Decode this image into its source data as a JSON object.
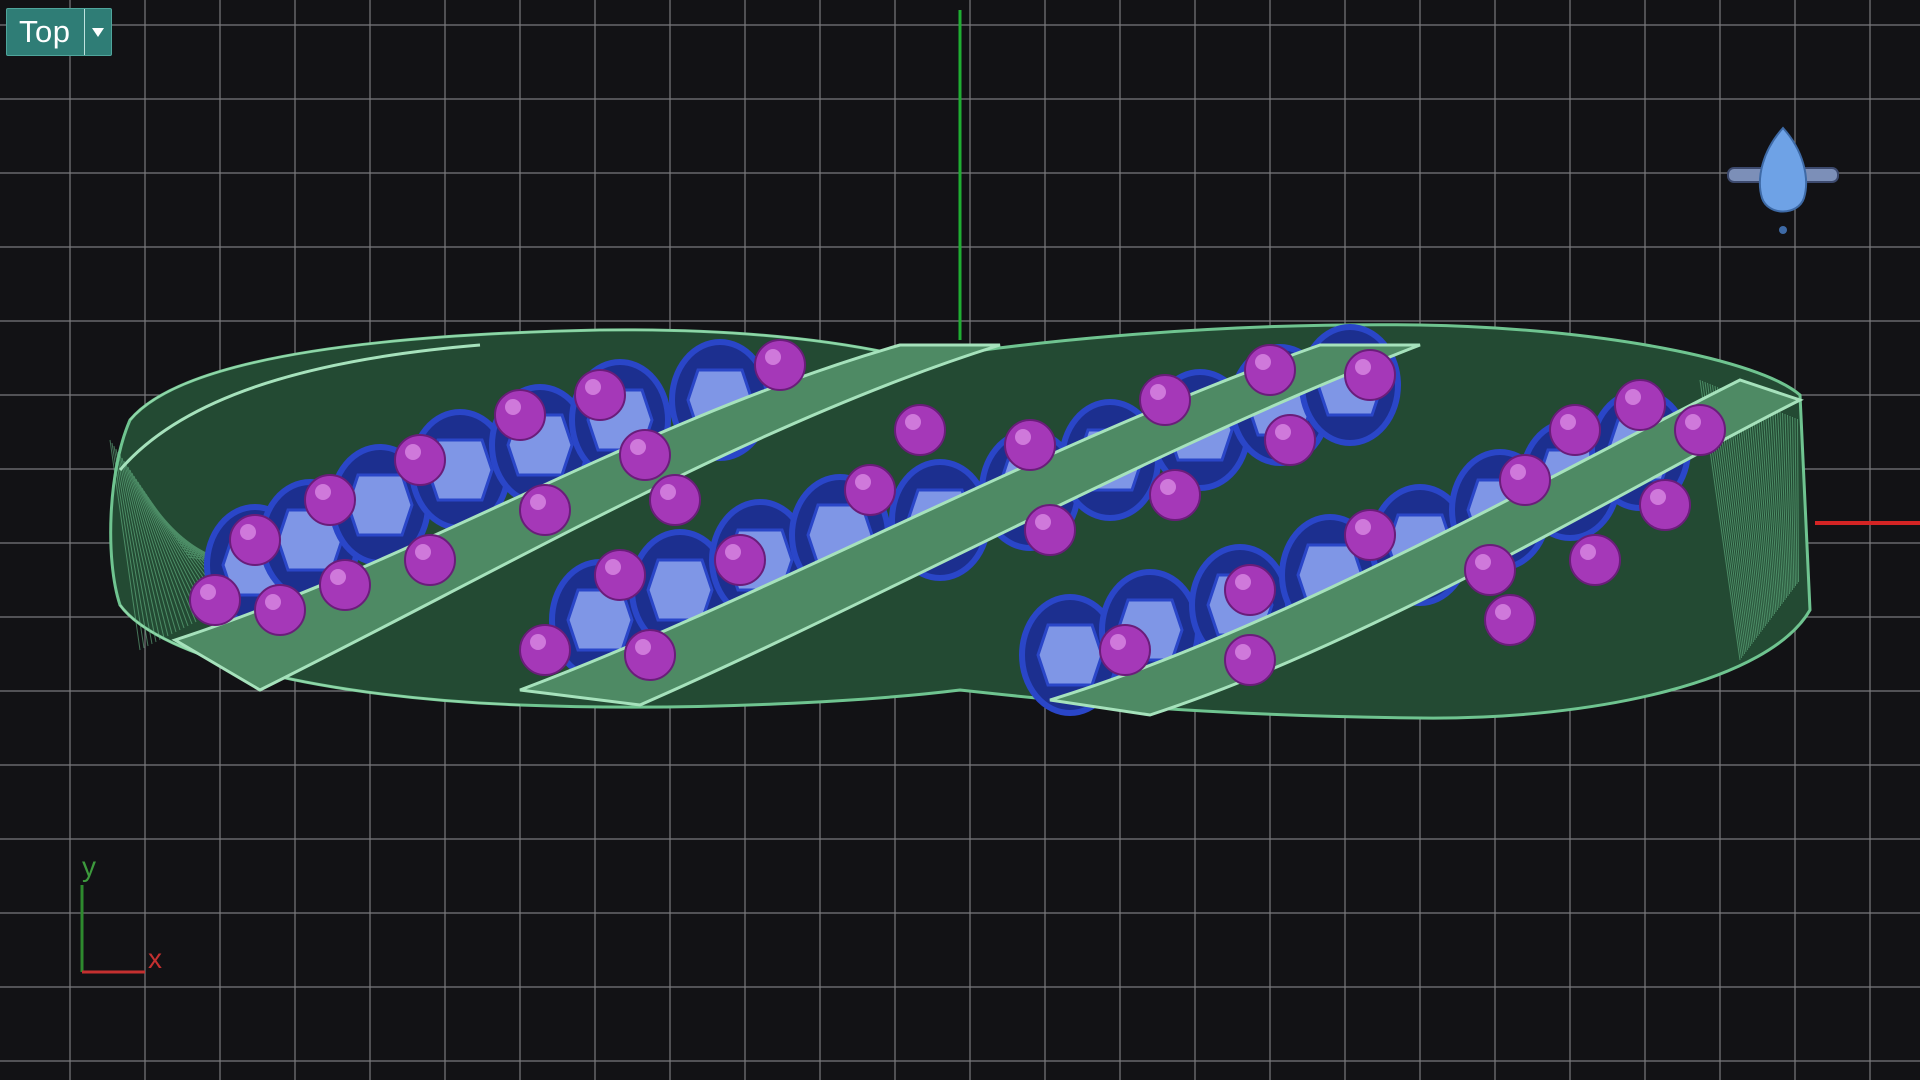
{
  "viewport": {
    "view_name": "Top",
    "view_menu_icon": "chevron-down-icon",
    "axis_labels": {
      "x": "x",
      "y": "y"
    },
    "thumbnail_icon": "pear-ring-preview-icon",
    "colors": {
      "background": "#121215",
      "grid": "#7a7a7d",
      "y_axis": "#1fae32",
      "x_axis": "#d42424",
      "band_wire": "#6fc490",
      "band_fill": "#4e8a64",
      "gem_setting": "#2a46c8",
      "gem_face": "#7f96e6",
      "accent_stone": "#a538b8",
      "tab_bg": "#2f7d76"
    }
  }
}
